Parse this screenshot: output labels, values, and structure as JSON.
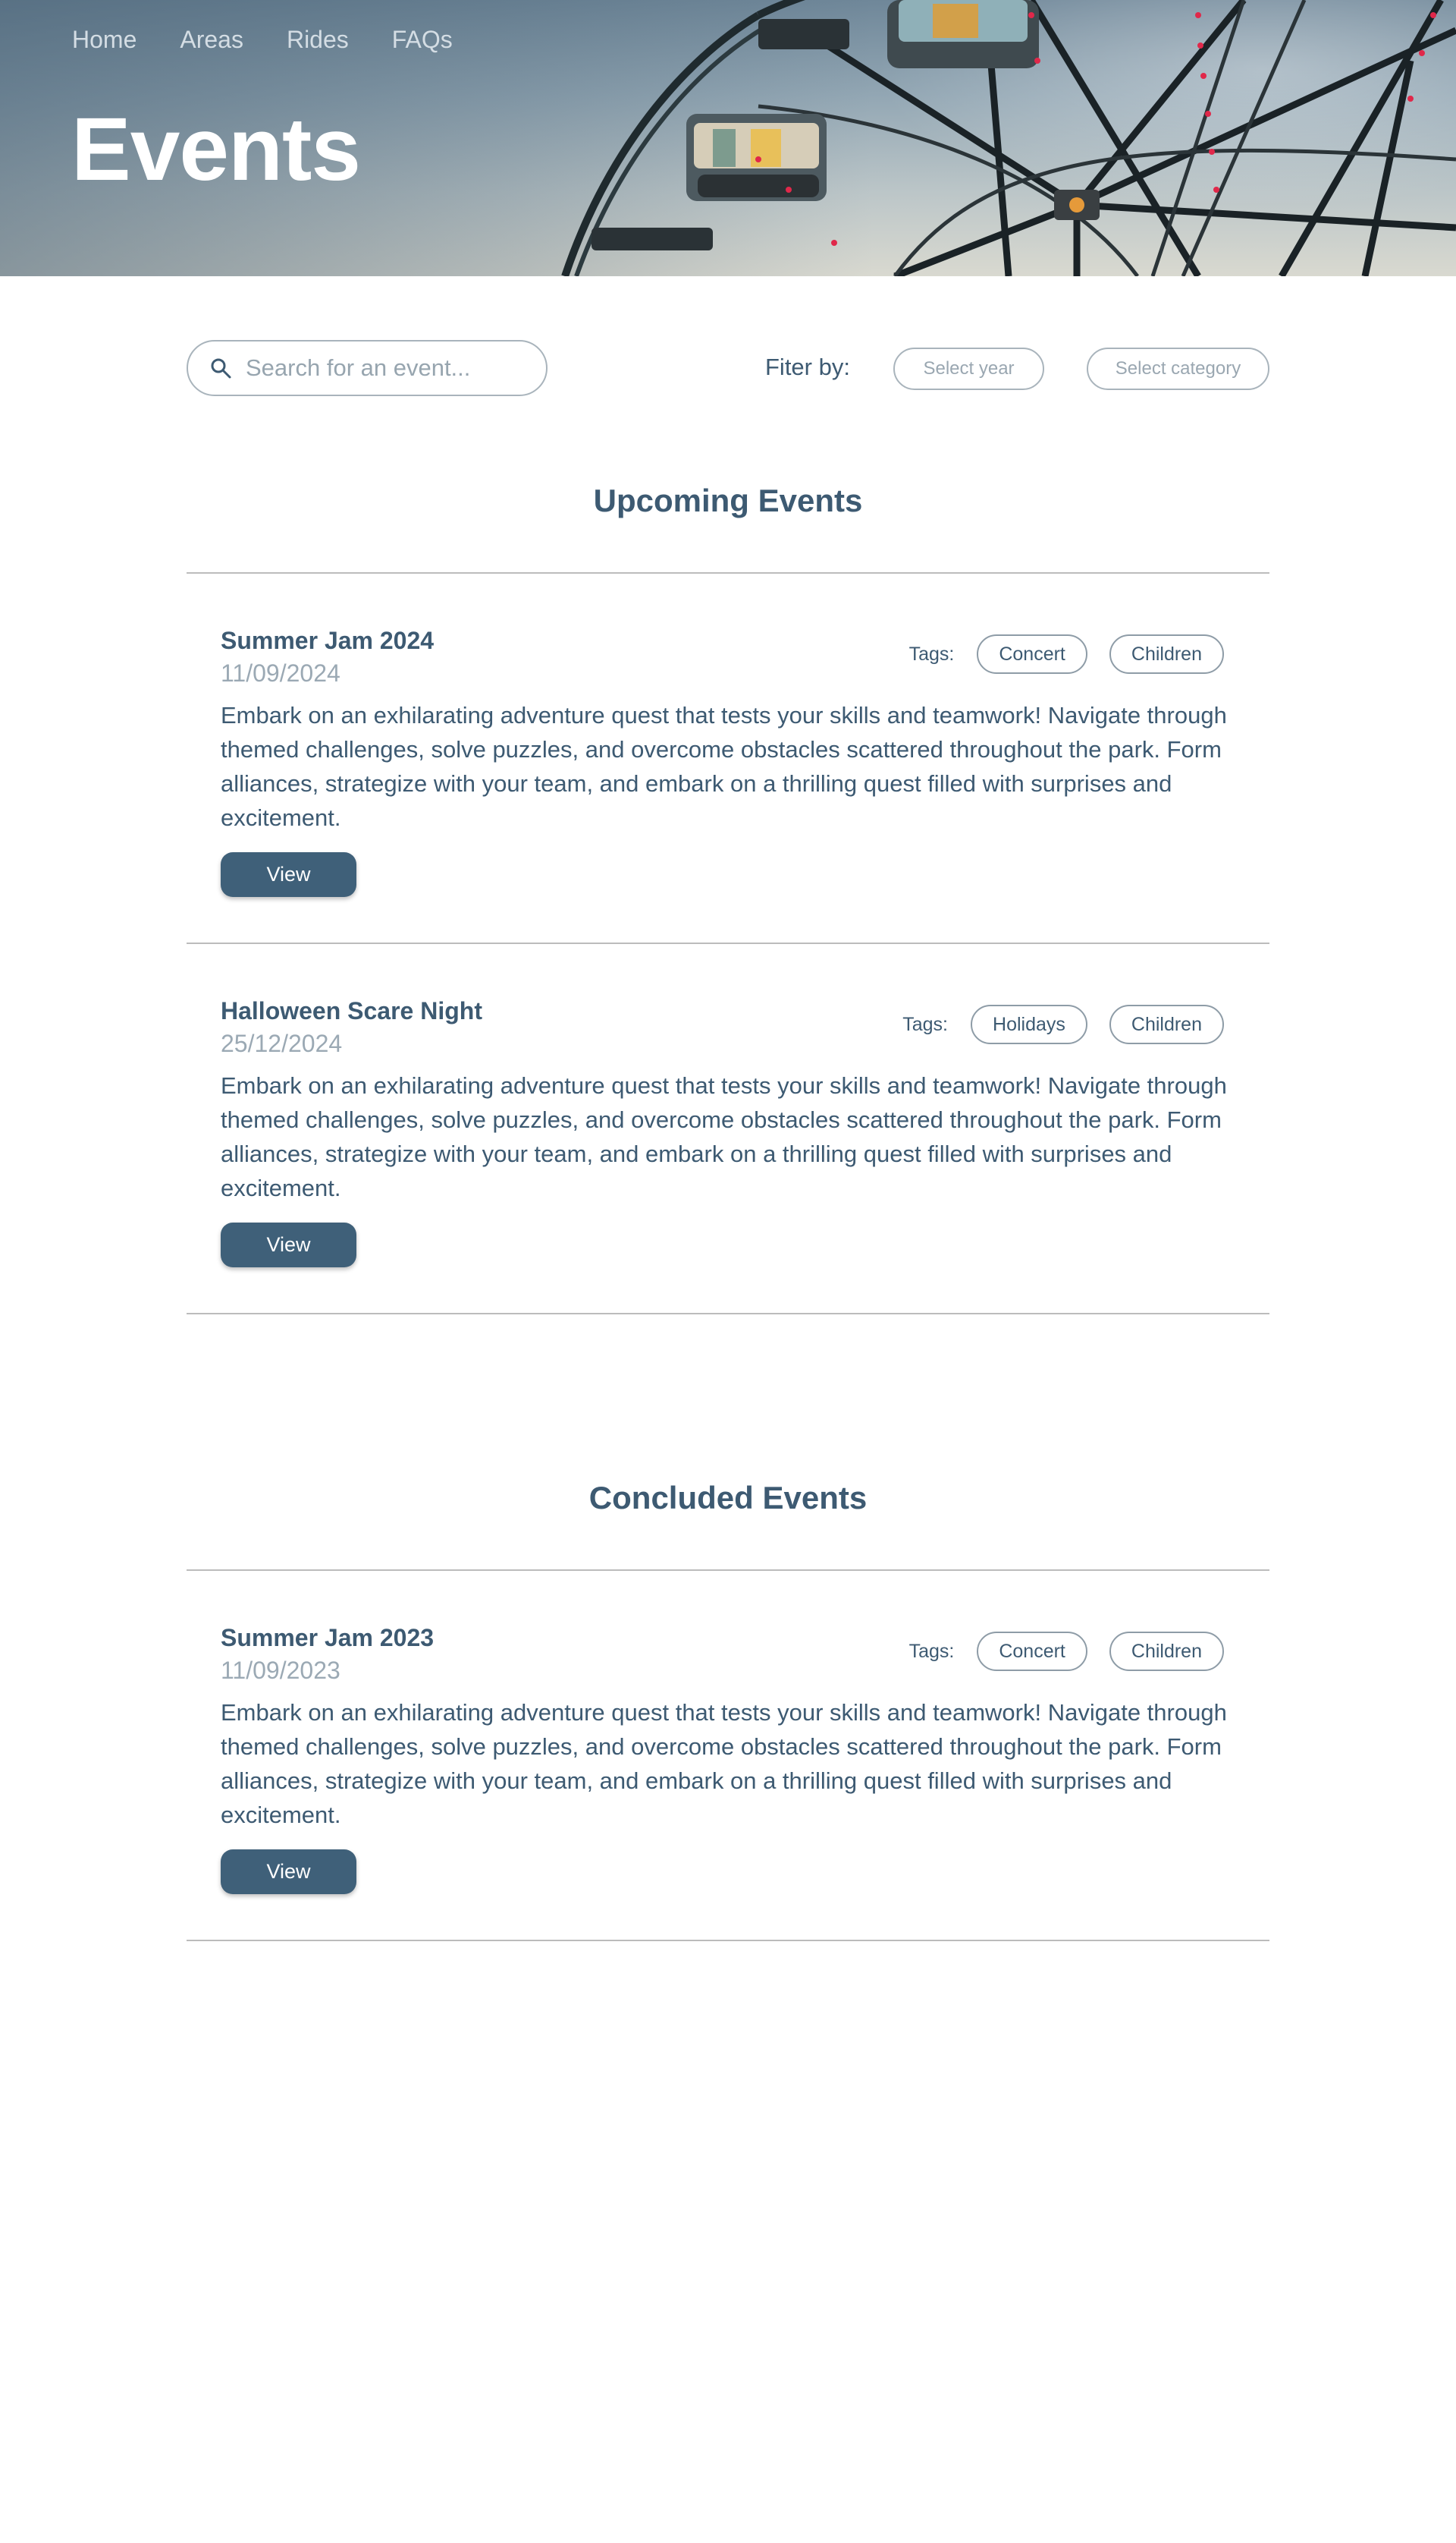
{
  "nav": {
    "items": [
      {
        "label": "Home"
      },
      {
        "label": "Areas"
      },
      {
        "label": "Rides"
      },
      {
        "label": "FAQs"
      }
    ]
  },
  "hero": {
    "title": "Events"
  },
  "filters": {
    "search_placeholder": "Search for an event...",
    "filter_label": "Fiter by:",
    "year_placeholder": "Select year",
    "category_placeholder": "Select category"
  },
  "sections": {
    "upcoming": {
      "title": "Upcoming Events",
      "events": [
        {
          "title": "Summer Jam 2024",
          "date": "11/09/2024",
          "tags_label": "Tags:",
          "tags": [
            "Concert",
            "Children"
          ],
          "description": "Embark on an exhilarating adventure quest that tests your skills and teamwork! Navigate through themed challenges, solve puzzles, and overcome obstacles scattered throughout the park. Form alliances, strategize with your team, and embark on a thrilling quest filled with surprises and excitement.",
          "button": "View"
        },
        {
          "title": "Halloween Scare Night",
          "date": "25/12/2024",
          "tags_label": "Tags:",
          "tags": [
            "Holidays",
            "Children"
          ],
          "description": "Embark on an exhilarating adventure quest that tests your skills and teamwork! Navigate through themed challenges, solve puzzles, and overcome obstacles scattered throughout the park. Form alliances, strategize with your team, and embark on a thrilling quest filled with surprises and excitement.",
          "button": "View"
        }
      ]
    },
    "concluded": {
      "title": "Concluded Events",
      "events": [
        {
          "title": "Summer Jam 2023",
          "date": "11/09/2023",
          "tags_label": "Tags:",
          "tags": [
            "Concert",
            "Children"
          ],
          "description": "Embark on an exhilarating adventure quest that tests your skills and teamwork! Navigate through themed challenges, solve puzzles, and overcome obstacles scattered throughout the park. Form alliances, strategize with your team, and embark on a thrilling quest filled with surprises and excitement.",
          "button": "View"
        }
      ]
    }
  },
  "colors": {
    "primary": "#3d5a72",
    "button": "#3f6079",
    "muted": "#9ba9b4",
    "rule": "#bcbcbc"
  },
  "icons": {
    "search": "search-icon",
    "hero_image": "ferris-wheel-image"
  }
}
